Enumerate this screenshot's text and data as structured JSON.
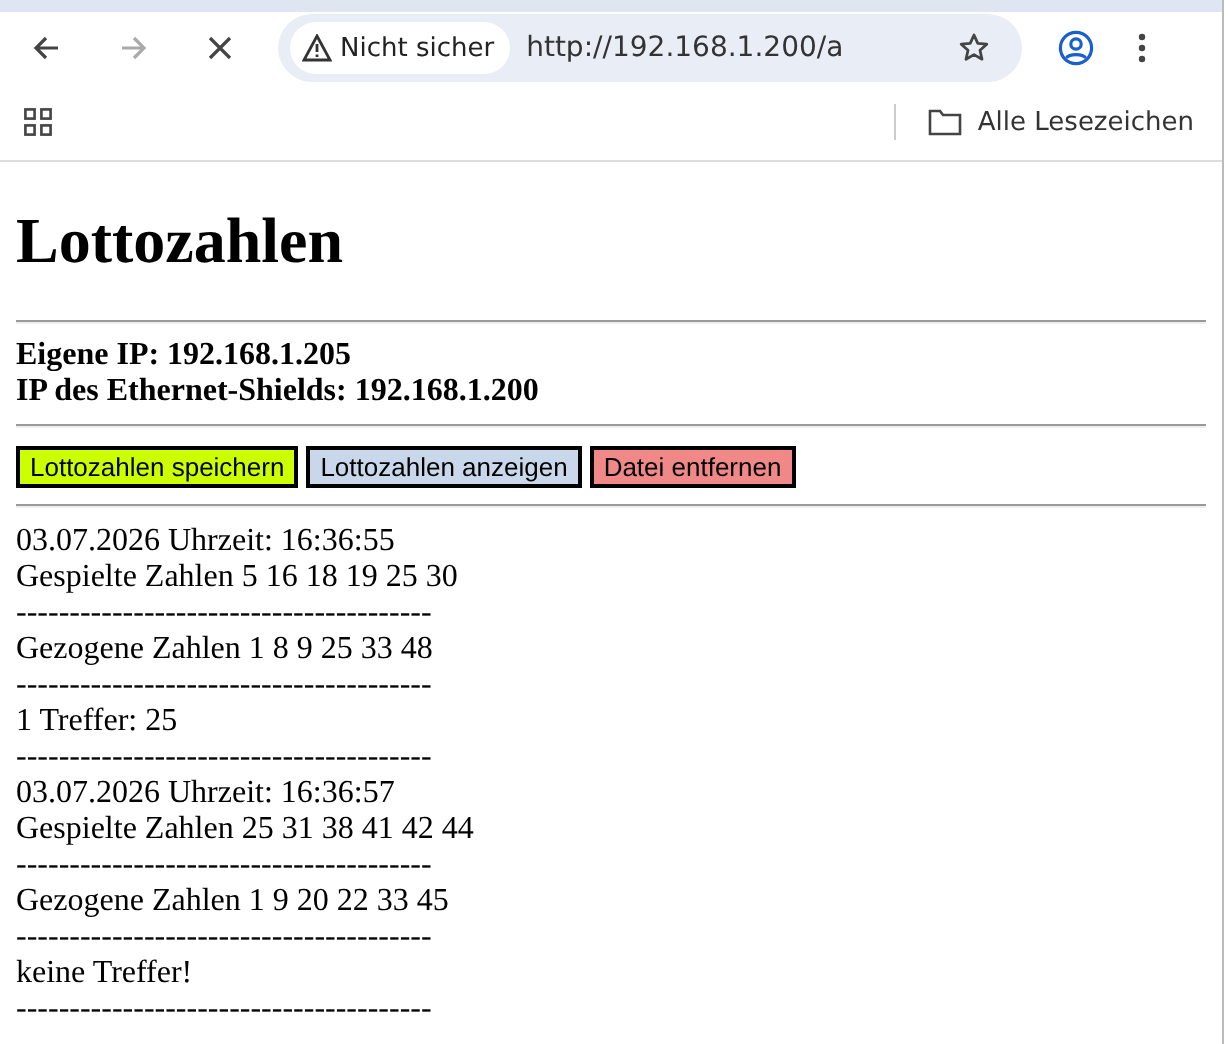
{
  "browser": {
    "security_label": "Nicht sicher",
    "url": "http://192.168.1.200/a",
    "bookmarks_label": "Alle Lesezeichen"
  },
  "page": {
    "title": "Lottozahlen",
    "info": [
      "Eigene IP: 192.168.1.205",
      "IP des Ethernet-Shields: 192.168.1.200"
    ],
    "buttons": [
      {
        "label": "Lottozahlen speichern",
        "color": "#ccff00"
      },
      {
        "label": "Lottozahlen anzeigen",
        "color": "#c8d8ea"
      },
      {
        "label": "Datei entfernen",
        "color": "#f08888"
      }
    ],
    "log": [
      "03.07.2026 Uhrzeit: 16:36:55",
      "Gespielte Zahlen 5 16 18 19 25 30",
      "---------------------------------------",
      "Gezogene Zahlen 1 8 9 25 33 48",
      "---------------------------------------",
      "1 Treffer: 25",
      "---------------------------------------",
      "03.07.2026 Uhrzeit: 16:36:57",
      "Gespielte Zahlen 25 31 38 41 42 44",
      "---------------------------------------",
      "Gezogene Zahlen 1 9 20 22 33 45",
      "---------------------------------------",
      "keine Treffer!",
      "---------------------------------------"
    ]
  }
}
